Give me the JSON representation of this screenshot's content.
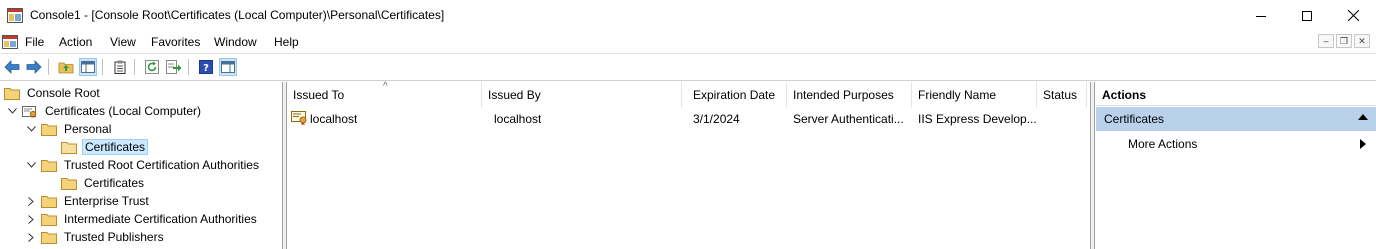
{
  "window": {
    "title": "Console1 - [Console Root\\Certificates (Local Computer)\\Personal\\Certificates]"
  },
  "menu": {
    "items": [
      "File",
      "Action",
      "View",
      "Favorites",
      "Window",
      "Help"
    ]
  },
  "tree": {
    "items": [
      {
        "label": "Console Root",
        "icon": "folder-icon",
        "selected": false
      },
      {
        "label": "Certificates (Local Computer)",
        "icon": "certificates-snapin-icon",
        "expanded": true
      },
      {
        "label": "Personal",
        "icon": "folder-icon",
        "expanded": true
      },
      {
        "label": "Certificates",
        "icon": "folder-icon",
        "selected": true
      },
      {
        "label": "Trusted Root Certification Authorities",
        "icon": "folder-icon",
        "expanded": true
      },
      {
        "label": "Certificates",
        "icon": "folder-icon"
      },
      {
        "label": "Enterprise Trust",
        "icon": "folder-icon",
        "expanded": false
      },
      {
        "label": "Intermediate Certification Authorities",
        "icon": "folder-icon",
        "expanded": false
      },
      {
        "label": "Trusted Publishers",
        "icon": "folder-icon",
        "expanded": false
      }
    ]
  },
  "list": {
    "columns": [
      "Issued To",
      "Issued By",
      "Expiration Date",
      "Intended Purposes",
      "Friendly Name",
      "Status"
    ],
    "sort_column": "Issued To",
    "rows": [
      {
        "issued_to": "localhost",
        "issued_by": "localhost",
        "expiration": "3/1/2024",
        "purposes": "Server Authenticati...",
        "friendly_name": "IIS Express Develop...",
        "status": ""
      }
    ]
  },
  "actions": {
    "header": "Actions",
    "section": "Certificates",
    "items": [
      "More Actions"
    ]
  },
  "colors": {
    "selection_bg": "#cce8ff",
    "actions_section_bg": "#b9d1ea",
    "toolbar_selected_bg": "#cce4f7"
  }
}
